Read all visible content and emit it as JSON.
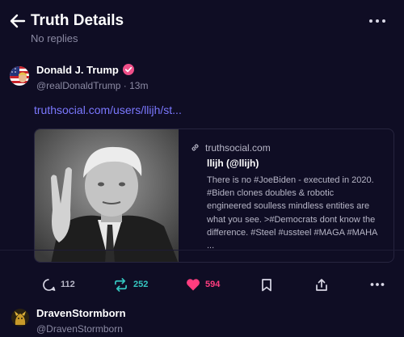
{
  "header": {
    "title": "Truth Details",
    "subtitle": "No replies"
  },
  "post": {
    "author_name": "Donald J. Trump",
    "handle_time": "@realDonaldTrump · 13m",
    "link": "truthsocial.com/users/llijh/st...",
    "card": {
      "domain": "truthsocial.com",
      "title": "llijh (@llijh)",
      "description": "There is no #JoeBiden - executed in 2020. #Biden clones doubles & robotic engineered soulless mindless entities are what you see. >#Democrats dont know the difference. #Steel #ussteel #MAGA #MAHA ..."
    },
    "actions": {
      "replies": "112",
      "retruths": "252",
      "likes": "594"
    }
  },
  "reply": {
    "author_name": "DravenStormborn",
    "handle": "@DravenStormborn"
  },
  "colors": {
    "background": "#0f0d24",
    "link": "#7b78ff",
    "retruth": "#35c6c0",
    "like": "#ff3d7f",
    "verified": "#ef4f89"
  },
  "icons": [
    "back-arrow-icon",
    "more-icon",
    "verified-icon",
    "link-icon",
    "reply-icon",
    "retruth-icon",
    "heart-icon",
    "bookmark-icon",
    "share-icon"
  ]
}
